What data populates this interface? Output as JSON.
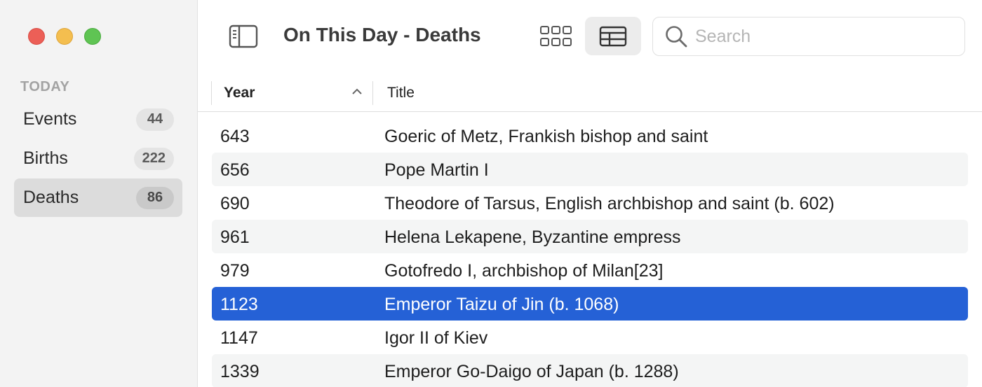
{
  "window": {
    "title": "On This Day - Deaths"
  },
  "sidebar": {
    "section_label": "TODAY",
    "items": [
      {
        "label": "Events",
        "count": "44"
      },
      {
        "label": "Births",
        "count": "222"
      },
      {
        "label": "Deaths",
        "count": "86",
        "selected": true
      }
    ]
  },
  "toolbar": {
    "sidebar_toggle_icon": "sidebar-icon",
    "grid_view_icon": "grid-view-icon",
    "table_view_icon": "table-view-icon",
    "search_placeholder": "Search",
    "search_value": ""
  },
  "table": {
    "columns": [
      {
        "label": "Year",
        "sort": "ascending"
      },
      {
        "label": "Title"
      }
    ],
    "rows": [
      {
        "year": "643",
        "title": "Goeric of Metz, Frankish bishop and saint"
      },
      {
        "year": "656",
        "title": "Pope Martin I"
      },
      {
        "year": "690",
        "title": "Theodore of Tarsus, English archbishop and saint (b. 602)"
      },
      {
        "year": "961",
        "title": "Helena Lekapene, Byzantine empress"
      },
      {
        "year": "979",
        "title": "Gotofredo I, archbishop of Milan[23]"
      },
      {
        "year": "1123",
        "title": "Emperor Taizu of Jin (b. 1068)",
        "selected": true
      },
      {
        "year": "1147",
        "title": "Igor II of Kiev"
      },
      {
        "year": "1339",
        "title": "Emperor Go-Daigo of Japan (b. 1288)"
      }
    ]
  },
  "colors": {
    "accent": "#2561d6",
    "sidebar_bg": "#f3f3f3",
    "close": "#ec5f57",
    "minimize": "#f4be4f",
    "maximize": "#5fc453"
  }
}
